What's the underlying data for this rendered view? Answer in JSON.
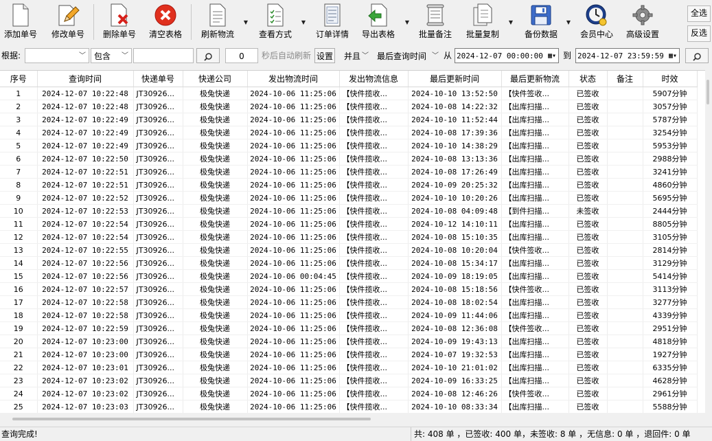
{
  "toolbar": {
    "add": "添加单号",
    "edit": "修改单号",
    "delete": "删除单号",
    "clear": "清空表格",
    "refresh": "刷新物流",
    "view_mode": "查看方式",
    "order_detail": "订单详情",
    "export": "导出表格",
    "batch_note": "批量备注",
    "batch_copy": "批量复制",
    "backup": "备份数据",
    "member": "会员中心",
    "advanced": "高级设置",
    "select_all": "全选",
    "invert": "反选"
  },
  "filter": {
    "basis_label": "根据:",
    "basis_value": "",
    "match": "包含",
    "keyword": "",
    "interval": "0",
    "auto_refresh_label": "秒后自动刷新",
    "set_button": "设置",
    "logic": "并且",
    "time_field": "最后查询时间",
    "from_label": "从",
    "from_value": "2024-12-07 00:00:00",
    "to_label": "到",
    "to_value": "2024-12-07 23:59:59"
  },
  "table": {
    "headers": [
      "序号",
      "查询时间",
      "快递单号",
      "快递公司",
      "发出物流时间",
      "发出物流信息",
      "最后更新时间",
      "最后更新物流",
      "状态",
      "备注",
      "时效"
    ],
    "rows": [
      [
        "1",
        "2024-12-07 10:22:48",
        "JT30926...",
        "极兔快递",
        "2024-10-06 11:25:06",
        "【快件揽收...",
        "2024-10-10 13:52:50",
        "【快件签收...",
        "已签收",
        "",
        "5907分钟"
      ],
      [
        "2",
        "2024-12-07 10:22:48",
        "JT30926...",
        "极兔快递",
        "2024-10-06 11:25:06",
        "【快件揽收...",
        "2024-10-08 14:22:32",
        "【出库扫描...",
        "已签收",
        "",
        "3057分钟"
      ],
      [
        "3",
        "2024-12-07 10:22:49",
        "JT30926...",
        "极兔快递",
        "2024-10-06 11:25:06",
        "【快件揽收...",
        "2024-10-10 11:52:44",
        "【出库扫描...",
        "已签收",
        "",
        "5787分钟"
      ],
      [
        "4",
        "2024-12-07 10:22:49",
        "JT30926...",
        "极兔快递",
        "2024-10-06 11:25:06",
        "【快件揽收...",
        "2024-10-08 17:39:36",
        "【出库扫描...",
        "已签收",
        "",
        "3254分钟"
      ],
      [
        "5",
        "2024-12-07 10:22:49",
        "JT30926...",
        "极兔快递",
        "2024-10-06 11:25:06",
        "【快件揽收...",
        "2024-10-10 14:38:29",
        "【出库扫描...",
        "已签收",
        "",
        "5953分钟"
      ],
      [
        "6",
        "2024-12-07 10:22:50",
        "JT30926...",
        "极兔快递",
        "2024-10-06 11:25:06",
        "【快件揽收...",
        "2024-10-08 13:13:36",
        "【出库扫描...",
        "已签收",
        "",
        "2988分钟"
      ],
      [
        "7",
        "2024-12-07 10:22:51",
        "JT30926...",
        "极兔快递",
        "2024-10-06 11:25:06",
        "【快件揽收...",
        "2024-10-08 17:26:49",
        "【出库扫描...",
        "已签收",
        "",
        "3241分钟"
      ],
      [
        "8",
        "2024-12-07 10:22:51",
        "JT30926...",
        "极兔快递",
        "2024-10-06 11:25:06",
        "【快件揽收...",
        "2024-10-09 20:25:32",
        "【出库扫描...",
        "已签收",
        "",
        "4860分钟"
      ],
      [
        "9",
        "2024-12-07 10:22:52",
        "JT30926...",
        "极兔快递",
        "2024-10-06 11:25:06",
        "【快件揽收...",
        "2024-10-10 10:20:26",
        "【出库扫描...",
        "已签收",
        "",
        "5695分钟"
      ],
      [
        "10",
        "2024-12-07 10:22:53",
        "JT30926...",
        "极兔快递",
        "2024-10-06 11:25:06",
        "【快件揽收...",
        "2024-10-08 04:09:48",
        "【到件扫描...",
        "未签收",
        "",
        "2444分钟"
      ],
      [
        "11",
        "2024-12-07 10:22:54",
        "JT30926...",
        "极兔快递",
        "2024-10-06 11:25:06",
        "【快件揽收...",
        "2024-10-12 14:10:11",
        "【出库扫描...",
        "已签收",
        "",
        "8805分钟"
      ],
      [
        "12",
        "2024-12-07 10:22:54",
        "JT30926...",
        "极兔快递",
        "2024-10-06 11:25:06",
        "【快件揽收...",
        "2024-10-08 15:10:35",
        "【出库扫描...",
        "已签收",
        "",
        "3105分钟"
      ],
      [
        "13",
        "2024-12-07 10:22:55",
        "JT30926...",
        "极兔快递",
        "2024-10-06 11:25:06",
        "【快件揽收...",
        "2024-10-08 10:20:04",
        "【快件签收...",
        "已签收",
        "",
        "2814分钟"
      ],
      [
        "14",
        "2024-12-07 10:22:56",
        "JT30926...",
        "极兔快递",
        "2024-10-06 11:25:06",
        "【快件揽收...",
        "2024-10-08 15:34:17",
        "【出库扫描...",
        "已签收",
        "",
        "3129分钟"
      ],
      [
        "15",
        "2024-12-07 10:22:56",
        "JT30926...",
        "极兔快递",
        "2024-10-06 00:04:45",
        "【快件揽收...",
        "2024-10-09 18:19:05",
        "【出库扫描...",
        "已签收",
        "",
        "5414分钟"
      ],
      [
        "16",
        "2024-12-07 10:22:57",
        "JT30926...",
        "极兔快递",
        "2024-10-06 11:25:06",
        "【快件揽收...",
        "2024-10-08 15:18:56",
        "【快件签收...",
        "已签收",
        "",
        "3113分钟"
      ],
      [
        "17",
        "2024-12-07 10:22:58",
        "JT30926...",
        "极兔快递",
        "2024-10-06 11:25:06",
        "【快件揽收...",
        "2024-10-08 18:02:54",
        "【出库扫描...",
        "已签收",
        "",
        "3277分钟"
      ],
      [
        "18",
        "2024-12-07 10:22:58",
        "JT30926...",
        "极兔快递",
        "2024-10-06 11:25:06",
        "【快件揽收...",
        "2024-10-09 11:44:06",
        "【出库扫描...",
        "已签收",
        "",
        "4339分钟"
      ],
      [
        "19",
        "2024-12-07 10:22:59",
        "JT30926...",
        "极兔快递",
        "2024-10-06 11:25:06",
        "【快件揽收...",
        "2024-10-08 12:36:08",
        "【快件签收...",
        "已签收",
        "",
        "2951分钟"
      ],
      [
        "20",
        "2024-12-07 10:23:00",
        "JT30926...",
        "极兔快递",
        "2024-10-06 11:25:06",
        "【快件揽收...",
        "2024-10-09 19:43:13",
        "【出库扫描...",
        "已签收",
        "",
        "4818分钟"
      ],
      [
        "21",
        "2024-12-07 10:23:00",
        "JT30926...",
        "极兔快递",
        "2024-10-06 11:25:06",
        "【快件揽收...",
        "2024-10-07 19:32:53",
        "【出库扫描...",
        "已签收",
        "",
        "1927分钟"
      ],
      [
        "22",
        "2024-12-07 10:23:01",
        "JT30926...",
        "极兔快递",
        "2024-10-06 11:25:06",
        "【快件揽收...",
        "2024-10-10 21:01:02",
        "【出库扫描...",
        "已签收",
        "",
        "6335分钟"
      ],
      [
        "23",
        "2024-12-07 10:23:02",
        "JT30926...",
        "极兔快递",
        "2024-10-06 11:25:06",
        "【快件揽收...",
        "2024-10-09 16:33:25",
        "【出库扫描...",
        "已签收",
        "",
        "4628分钟"
      ],
      [
        "24",
        "2024-12-07 10:23:02",
        "JT30926...",
        "极兔快递",
        "2024-10-06 11:25:06",
        "【快件揽收...",
        "2024-10-08 12:46:26",
        "【快件签收...",
        "已签收",
        "",
        "2961分钟"
      ],
      [
        "25",
        "2024-12-07 10:23:03",
        "JT30926...",
        "极兔快递",
        "2024-10-06 11:25:06",
        "【快件揽收...",
        "2024-10-10 08:33:34",
        "【出库扫描...",
        "已签收",
        "",
        "5588分钟"
      ]
    ]
  },
  "status": {
    "left": "查询完成!",
    "summary": "共: 408 单 ，已签收:  400 单，未签收:  8 单 ，无信息: 0 单 ，退回件: 0 单"
  },
  "colors": {
    "accent_red": "#e0301e",
    "accent_blue": "#1f5fb8",
    "grid_line": "#ececec"
  }
}
